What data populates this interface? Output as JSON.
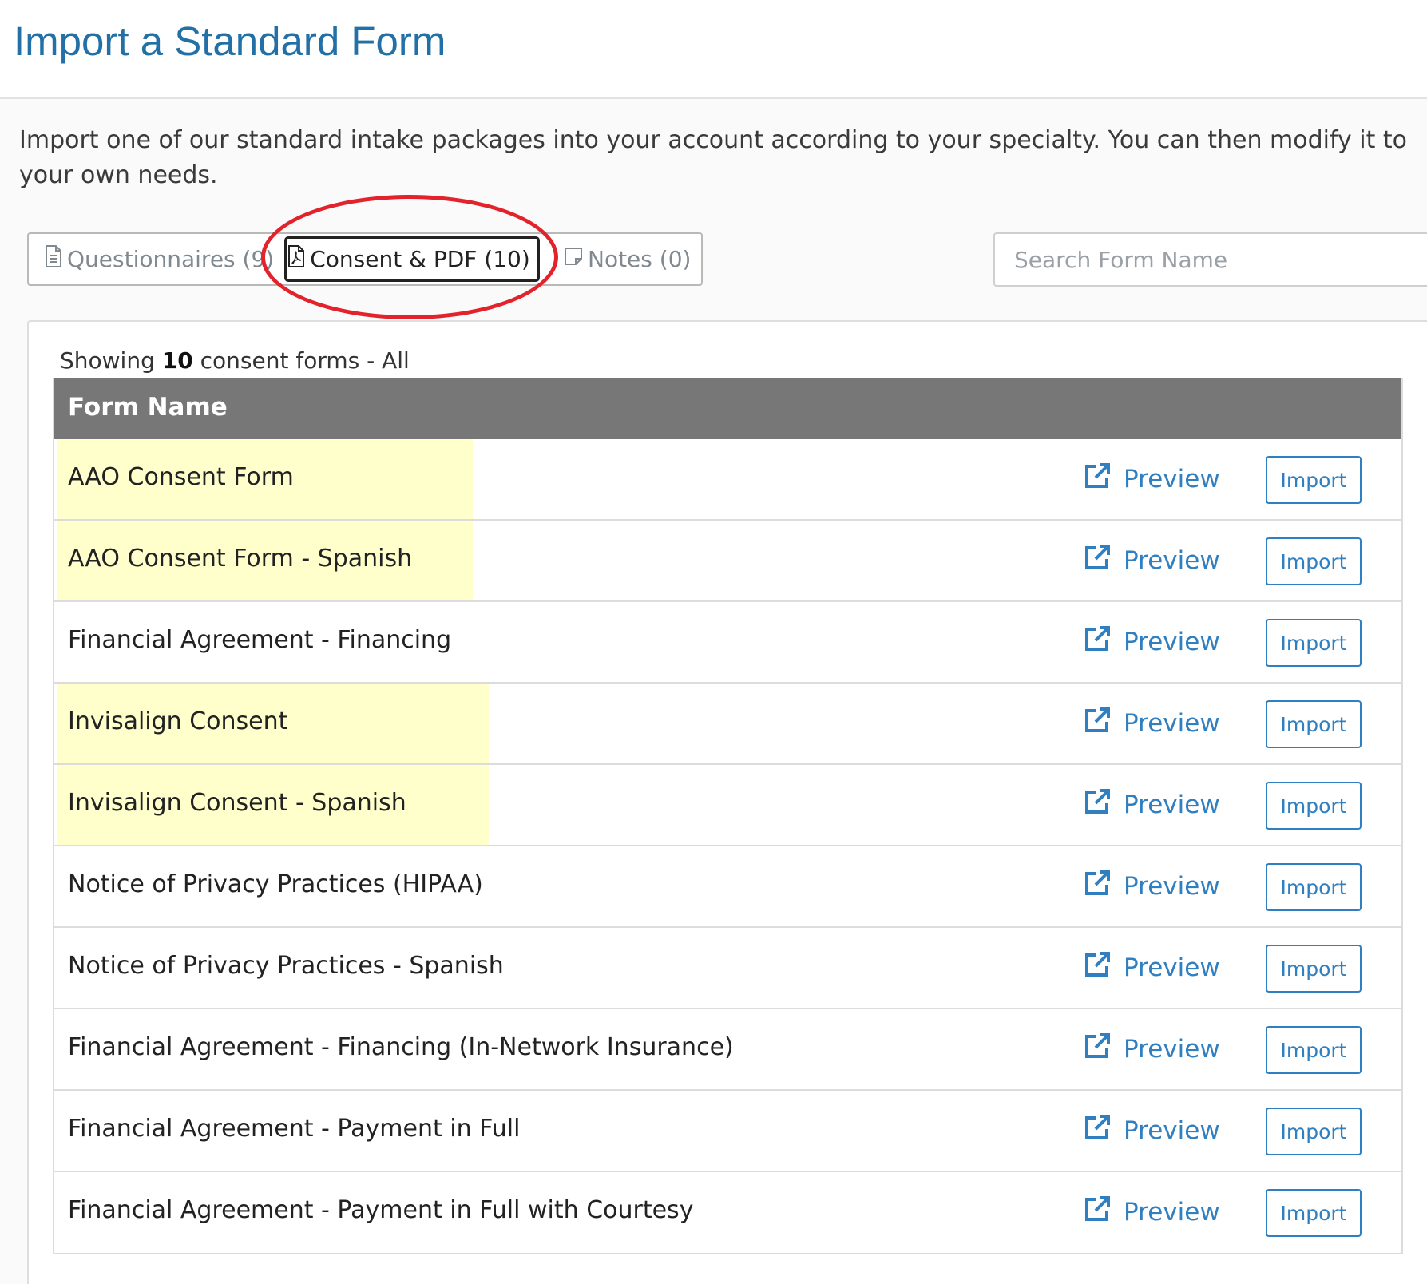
{
  "page": {
    "title": "Import a Standard Form",
    "intro": "Import one of our standard intake packages into your account according to your specialty. You can then modify it to your own needs."
  },
  "tabs": [
    {
      "label": "Questionnaires (9)",
      "icon": "document-icon",
      "active": false
    },
    {
      "label": "Consent & PDF (10)",
      "icon": "pdf-icon",
      "active": true
    },
    {
      "label": "Notes (0)",
      "icon": "note-icon",
      "active": false
    }
  ],
  "search": {
    "placeholder": "Search Form Name",
    "value": ""
  },
  "summary": {
    "prefix": "Showing",
    "count": "10",
    "suffix": "consent forms - All"
  },
  "table": {
    "header": "Form Name",
    "preview_label": "Preview",
    "import_label": "Import",
    "rows": [
      {
        "name": "AAO Consent Form",
        "highlighted": true
      },
      {
        "name": "AAO Consent Form - Spanish",
        "highlighted": true
      },
      {
        "name": "Financial Agreement - Financing",
        "highlighted": false
      },
      {
        "name": "Invisalign Consent",
        "highlighted": true
      },
      {
        "name": "Invisalign Consent - Spanish",
        "highlighted": true
      },
      {
        "name": "Notice of Privacy Practices (HIPAA)",
        "highlighted": false
      },
      {
        "name": "Notice of Privacy Practices - Spanish",
        "highlighted": false
      },
      {
        "name": "Financial Agreement - Financing (In-Network Insurance)",
        "highlighted": false
      },
      {
        "name": "Financial Agreement - Payment in Full",
        "highlighted": false
      },
      {
        "name": "Financial Agreement - Payment in Full with Courtesy",
        "highlighted": false
      }
    ]
  },
  "colors": {
    "title": "#2270a6",
    "link": "#2f7fc1",
    "header_bg": "#777777",
    "highlight": "#ffffcc",
    "annotation": "#e3232b"
  }
}
